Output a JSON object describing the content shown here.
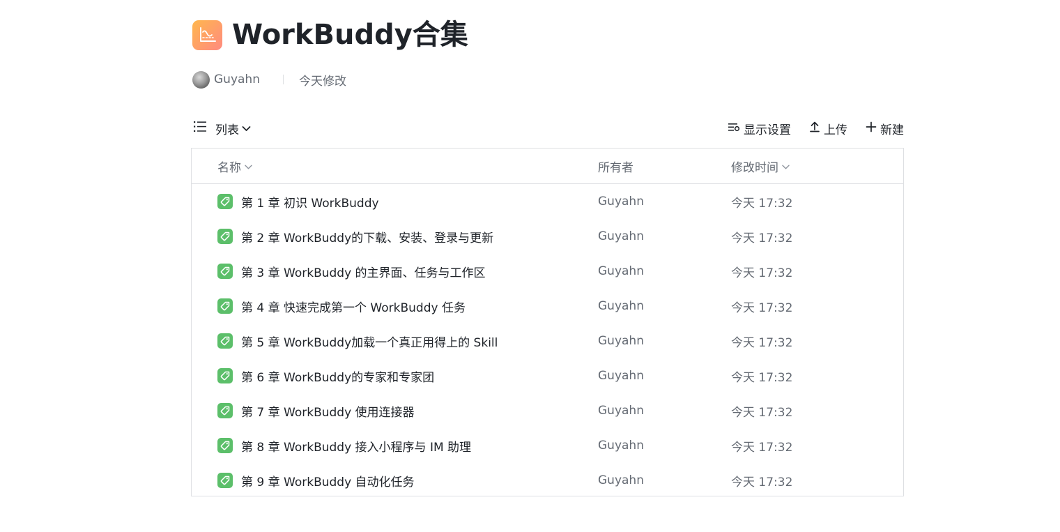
{
  "header": {
    "title": "WorkBuddy合集",
    "owner": "Guyahn",
    "modified": "今天修改"
  },
  "toolbar": {
    "view_label": "列表",
    "display_settings_label": "显示设置",
    "upload_label": "上传",
    "new_label": "新建"
  },
  "table": {
    "columns": {
      "name": "名称",
      "owner": "所有者",
      "modified": "修改时间"
    },
    "rows": [
      {
        "name": "第 1 章 初识 WorkBuddy",
        "owner": "Guyahn",
        "modified": "今天 17:32"
      },
      {
        "name": "第 2 章 WorkBuddy的下载、安装、登录与更新",
        "owner": "Guyahn",
        "modified": "今天 17:32"
      },
      {
        "name": "第 3 章 WorkBuddy 的主界面、任务与工作区",
        "owner": "Guyahn",
        "modified": "今天 17:32"
      },
      {
        "name": "第 4 章 快速完成第一个 WorkBuddy 任务",
        "owner": "Guyahn",
        "modified": "今天 17:32"
      },
      {
        "name": "第 5 章 WorkBuddy加载一个真正用得上的 Skill",
        "owner": "Guyahn",
        "modified": "今天 17:32"
      },
      {
        "name": "第 6 章 WorkBuddy的专家和专家团",
        "owner": "Guyahn",
        "modified": "今天 17:32"
      },
      {
        "name": "第 7 章 WorkBuddy 使用连接器",
        "owner": "Guyahn",
        "modified": "今天 17:32"
      },
      {
        "name": "第 8 章 WorkBuddy 接入小程序与 IM 助理",
        "owner": "Guyahn",
        "modified": "今天 17:32"
      },
      {
        "name": "第 9 章 WorkBuddy 自动化任务",
        "owner": "Guyahn",
        "modified": "今天 17:32"
      }
    ]
  },
  "icons": {
    "app": "chart-line-icon",
    "doc": "tag-icon",
    "list_view": "list-icon",
    "display_settings": "settings-sliders-icon",
    "upload": "upload-icon",
    "new": "plus-icon",
    "sort": "chevron-down-icon"
  },
  "colors": {
    "app_icon_gradient_start": "#ffb74d",
    "app_icon_gradient_end": "#ff8a80",
    "doc_icon": "#5cbf6a",
    "text_primary": "#1f2329",
    "text_secondary": "#646a73",
    "border": "#dee0e3"
  }
}
